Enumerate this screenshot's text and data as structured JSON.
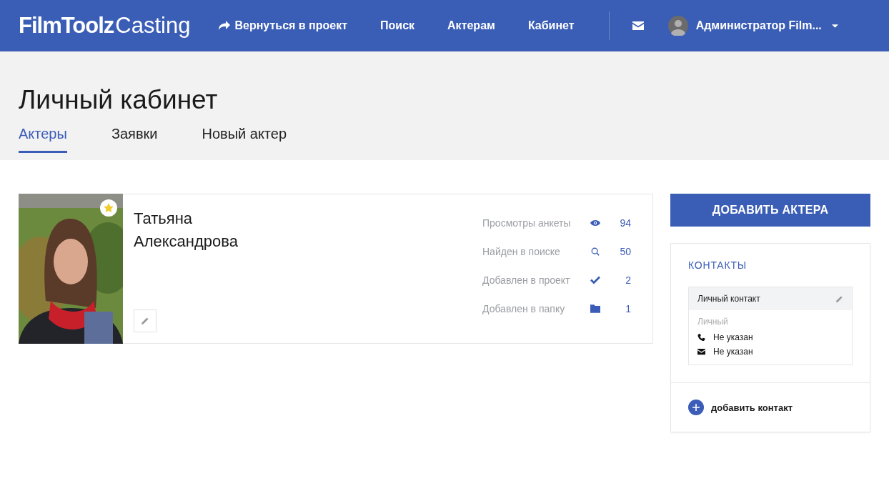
{
  "header": {
    "logo": {
      "bold": "FilmToolz",
      "light": "Casting"
    },
    "nav": [
      {
        "label": "Вернуться в проект",
        "kind": "back"
      },
      {
        "label": "Поиск",
        "kind": "plain"
      },
      {
        "label": "Актерам",
        "kind": "plain"
      },
      {
        "label": "Кабинет",
        "kind": "plain"
      }
    ],
    "user": {
      "name": "Администратор Film..."
    }
  },
  "page": {
    "title": "Личный кабинет",
    "tabs": [
      {
        "label": "Актеры",
        "selected": true
      },
      {
        "label": "Заявки",
        "selected": false
      },
      {
        "label": "Новый актер",
        "selected": false
      }
    ]
  },
  "actor": {
    "name": "Татьяна Александрова",
    "favorite": true,
    "stats": [
      {
        "label": "Просмотры анкеты",
        "kind": "views",
        "value": "94"
      },
      {
        "label": "Найден в поиске",
        "kind": "search",
        "value": "50"
      },
      {
        "label": "Добавлен в проект",
        "kind": "project",
        "value": "2"
      },
      {
        "label": "Добавлен в папку",
        "kind": "folder",
        "value": "1"
      }
    ]
  },
  "sidebar": {
    "add_button": "ДОБАВИТЬ АКТЕРА",
    "contacts_title": "КОНТАКТЫ",
    "contact": {
      "title": "Личный контакт",
      "type": "Личный",
      "phone": "Не указан",
      "email": "Не указан"
    },
    "add_contact": "добавить контакт"
  }
}
